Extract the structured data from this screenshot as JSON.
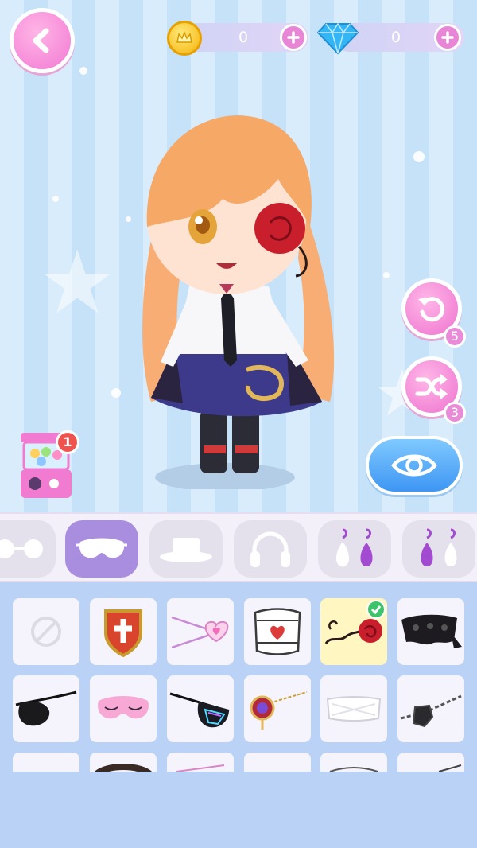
{
  "currency": {
    "coins": {
      "icon": "coin-icon",
      "amount": "0"
    },
    "gems": {
      "icon": "diamond-icon",
      "amount": "0"
    }
  },
  "controls": {
    "undo": {
      "icon": "undo-icon",
      "count": "5"
    },
    "shuffle": {
      "icon": "shuffle-icon",
      "count": "3"
    },
    "preview": {
      "icon": "eye-icon"
    },
    "gacha": {
      "icon": "gacha-machine-icon",
      "badge": "1"
    }
  },
  "categories": [
    {
      "icon": "glasses-icon",
      "active": false
    },
    {
      "icon": "eye-mask-icon",
      "active": true
    },
    {
      "icon": "hat-icon",
      "active": false
    },
    {
      "icon": "headphones-icon",
      "active": false
    },
    {
      "icon": "earrings-icon",
      "active": false
    },
    {
      "icon": "earrings-alt-icon",
      "active": false
    }
  ],
  "items": [
    {
      "icon": "none-icon",
      "selected": false
    },
    {
      "icon": "cross-shield-patch-icon",
      "selected": false
    },
    {
      "icon": "heart-clip-icon",
      "selected": false
    },
    {
      "icon": "heart-bandage-icon",
      "selected": false
    },
    {
      "icon": "rose-vine-icon",
      "selected": true
    },
    {
      "icon": "black-lace-icon",
      "selected": false
    },
    {
      "icon": "black-eyepatch-icon",
      "selected": false
    },
    {
      "icon": "pink-sleep-mask-icon",
      "selected": false
    },
    {
      "icon": "neon-eyepatch-icon",
      "selected": false
    },
    {
      "icon": "jewel-chain-icon",
      "selected": false
    },
    {
      "icon": "white-bandage-icon",
      "selected": false
    },
    {
      "icon": "chain-eyepatch-icon",
      "selected": false
    }
  ],
  "colors": {
    "accent_pink": "#ee72cf",
    "tab_active": "#a98ee0",
    "preview_blue": "#3e96f3",
    "selected_cell": "#fff6c2",
    "check_green": "#3dc46b"
  }
}
